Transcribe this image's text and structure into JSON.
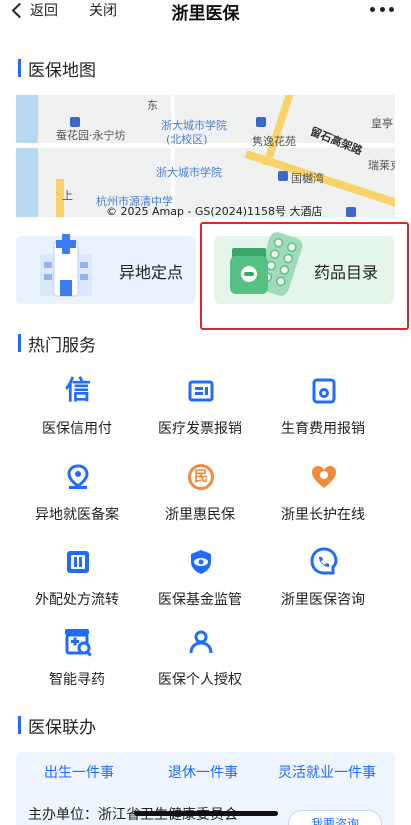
{
  "topbar": {
    "back_label": "返回",
    "close_label": "关闭",
    "title": "浙里医保"
  },
  "map_section": {
    "title": "医保地图",
    "labels": [
      "东",
      "浙大城市学院",
      "(北校区)",
      "蚕花园·永宁坊",
      "隽逸花苑",
      "留石高架路",
      "瑞莱克",
      "皇亭",
      "浙大城市学院",
      "国樾湾",
      "上",
      "杭州市源清中学"
    ],
    "copyright": "© 2025 Amap - GS(2024)1158号 大酒店"
  },
  "cards": {
    "remote": "异地定点",
    "drug": "药品目录"
  },
  "hot_services": {
    "title": "热门服务",
    "items": [
      {
        "label": "医保信用付",
        "icon": "信"
      },
      {
        "label": "医疗发票报销",
        "icon": "invoice-icon"
      },
      {
        "label": "生育费用报销",
        "icon": "birth-icon"
      },
      {
        "label": "异地就医备案",
        "icon": "location-icon"
      },
      {
        "label": "浙里惠民保",
        "icon": "民"
      },
      {
        "label": "浙里长护在线",
        "icon": "care-icon"
      },
      {
        "label": "外配处方流转",
        "icon": "prescription-icon"
      },
      {
        "label": "医保基金监管",
        "icon": "eye-shield-icon"
      },
      {
        "label": "浙里医保咨询",
        "icon": "phone-icon"
      },
      {
        "label": "智能寻药",
        "icon": "pharmacy-icon"
      },
      {
        "label": "医保个人授权",
        "icon": "user-icon"
      }
    ]
  },
  "liaison": {
    "title": "医保联办",
    "tabs": [
      "出生一件事",
      "退休一件事",
      "灵活就业一件事"
    ],
    "host_text": "主办单位：浙江省卫生健康委员会",
    "consult_button": "我要咨询"
  },
  "colors": {
    "accent": "#1f6bff",
    "highlight": "#e0242b",
    "drug_card_bg": "#e4f5ea",
    "remote_card_bg": "#eaf2fd"
  }
}
